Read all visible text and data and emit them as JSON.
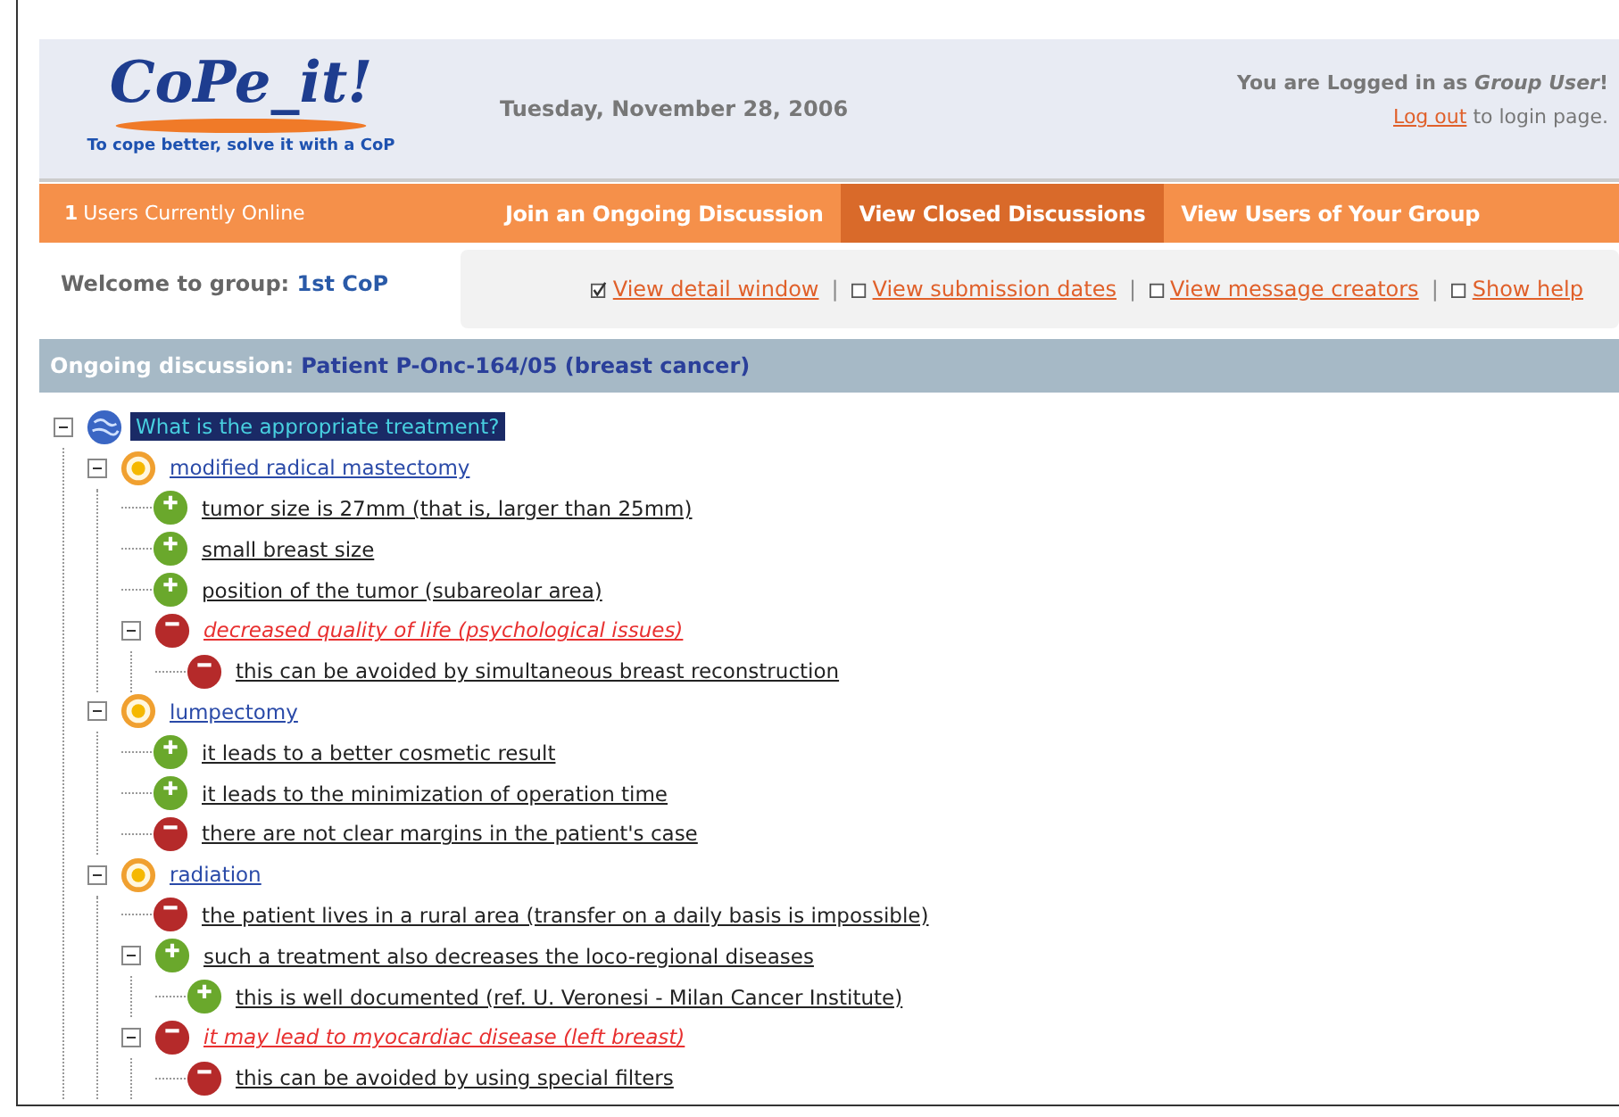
{
  "header": {
    "logo": "CoPe_it!",
    "tagline": "To cope better, solve it with a CoP",
    "date": "Tuesday, November 28, 2006",
    "login_prefix": "You are Logged in as",
    "login_user": "Group User",
    "login_suffix": "!",
    "logout_link": "Log out",
    "logout_suffix": "to login page."
  },
  "navbar": {
    "online_count": "1",
    "online_label": "Users Currently Online",
    "tabs": [
      {
        "label": "Join an Ongoing Discussion",
        "selected": false
      },
      {
        "label": "View Closed Discussions",
        "selected": true
      },
      {
        "label": "View Users of Your Group",
        "selected": false
      }
    ]
  },
  "welcome": {
    "label": "Welcome to group:",
    "group": "1st CoP"
  },
  "options_separator": "|",
  "options": [
    {
      "label": "View detail window",
      "checked": true
    },
    {
      "label": "View submission dates",
      "checked": false
    },
    {
      "label": "View message creators",
      "checked": false
    },
    {
      "label": "Show help",
      "checked": false
    }
  ],
  "discussion": {
    "label": "Ongoing discussion:",
    "title": "Patient P-Onc-164/05 (breast cancer)"
  },
  "tree": [
    {
      "kind": "issue",
      "text": "What is the appropriate treatment?",
      "selected": true,
      "alert": false,
      "expanded": true,
      "children": [
        {
          "kind": "alternative",
          "text": "modified radical mastectomy",
          "selected": false,
          "alert": false,
          "expanded": true,
          "children": [
            {
              "kind": "pro",
              "text": "tumor size is 27mm (that is, larger than 25mm)",
              "selected": false,
              "alert": false
            },
            {
              "kind": "pro",
              "text": "small breast size",
              "selected": false,
              "alert": false
            },
            {
              "kind": "pro",
              "text": "position of the tumor (subareolar area)",
              "selected": false,
              "alert": false
            },
            {
              "kind": "con",
              "text": "decreased quality of life (psychological issues)",
              "selected": false,
              "alert": true,
              "expanded": true,
              "children": [
                {
                  "kind": "con",
                  "text": "this can be avoided by simultaneous breast reconstruction",
                  "selected": false,
                  "alert": false
                }
              ]
            }
          ]
        },
        {
          "kind": "alternative",
          "text": "lumpectomy",
          "selected": false,
          "alert": false,
          "expanded": true,
          "children": [
            {
              "kind": "pro",
              "text": "it leads to a better cosmetic result",
              "selected": false,
              "alert": false
            },
            {
              "kind": "pro",
              "text": "it leads to the minimization of operation time",
              "selected": false,
              "alert": false
            },
            {
              "kind": "con",
              "text": "there are not clear margins in the patient's case",
              "selected": false,
              "alert": false
            }
          ]
        },
        {
          "kind": "alternative",
          "text": "radiation",
          "selected": false,
          "alert": false,
          "expanded": true,
          "children": [
            {
              "kind": "con",
              "text": "the patient lives in a rural area (transfer on a daily basis is impossible)",
              "selected": false,
              "alert": false
            },
            {
              "kind": "pro",
              "text": "such a treatment also decreases the loco-regional diseases",
              "selected": false,
              "alert": false,
              "expanded": true,
              "children": [
                {
                  "kind": "pro",
                  "text": "this is well documented (ref. U. Veronesi - Milan Cancer Institute)",
                  "selected": false,
                  "alert": false
                }
              ]
            },
            {
              "kind": "con",
              "text": "it may lead to myocardiac disease (left breast)",
              "selected": false,
              "alert": true,
              "expanded": true,
              "children": [
                {
                  "kind": "con",
                  "text": "this can be avoided by using special filters",
                  "selected": false,
                  "alert": false
                }
              ]
            }
          ]
        }
      ]
    }
  ]
}
